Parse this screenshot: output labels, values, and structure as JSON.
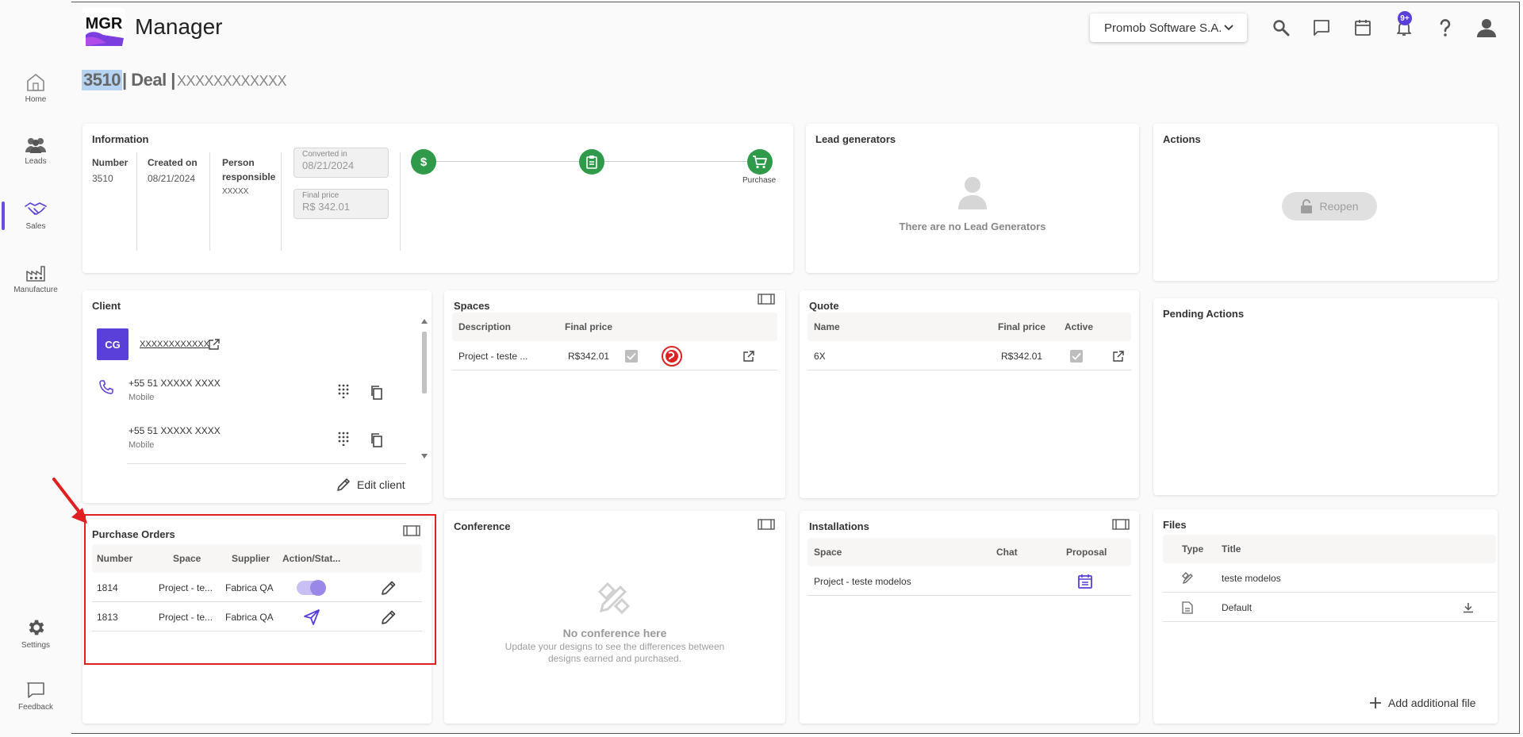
{
  "app": {
    "logo_text": "MGR",
    "title": "Manager"
  },
  "header": {
    "company": "Promob Software S.A.",
    "notification_badge": "9+"
  },
  "sidebar": [
    {
      "label": "Home",
      "icon": "home-icon"
    },
    {
      "label": "Leads",
      "icon": "people-icon"
    },
    {
      "label": "Sales",
      "icon": "handshake-icon",
      "active": true
    },
    {
      "label": "Manufacture",
      "icon": "factory-icon"
    },
    {
      "label": "Settings",
      "icon": "gear-icon"
    },
    {
      "label": "Feedback",
      "icon": "feedback-icon"
    }
  ],
  "deal": {
    "number": "3510",
    "label": "| Deal |",
    "name": "XXXXXXXXXXXX"
  },
  "information": {
    "title": "Information",
    "number_label": "Number",
    "number": "3510",
    "created_label": "Created on",
    "created": "08/21/2024",
    "person_label": "Person responsible",
    "person": "XXXXX",
    "converted_label": "Converted in",
    "converted": "08/21/2024",
    "price_label": "Final price",
    "price": "R$ 342.01",
    "step_label": "Purchase"
  },
  "lead_generators": {
    "title": "Lead generators",
    "empty": "There are no Lead Generators"
  },
  "actions": {
    "title": "Actions",
    "reopen": "Reopen"
  },
  "client": {
    "title": "Client",
    "initials": "CG",
    "name": "XXXXXXXXXXXX",
    "phones": [
      {
        "number": "+55 51 XXXXX XXXX",
        "type": "Mobile"
      },
      {
        "number": "+55 51 XXXXX XXXX",
        "type": "Mobile"
      }
    ],
    "edit": "Edit client"
  },
  "spaces": {
    "title": "Spaces",
    "headers": [
      "Description",
      "Final price"
    ],
    "rows": [
      {
        "description": "Project - teste ...",
        "price": "R$342.01"
      }
    ]
  },
  "quote": {
    "title": "Quote",
    "headers": [
      "Name",
      "Final price",
      "Active"
    ],
    "rows": [
      {
        "name": "6X",
        "price": "R$342.01"
      }
    ]
  },
  "pending_actions": {
    "title": "Pending Actions"
  },
  "purchase_orders": {
    "title": "Purchase Orders",
    "headers": [
      "Number",
      "Space",
      "Supplier",
      "Action/Stat..."
    ],
    "rows": [
      {
        "number": "1814",
        "space": "Project - te...",
        "supplier": "Fabrica QA"
      },
      {
        "number": "1813",
        "space": "Project - te...",
        "supplier": "Fabrica QA"
      }
    ]
  },
  "conference": {
    "title": "Conference",
    "empty_title": "No conference here",
    "empty_desc": "Update your designs to see the differences between designs earned and purchased."
  },
  "installations": {
    "title": "Installations",
    "headers": [
      "Space",
      "Chat",
      "Proposal"
    ],
    "rows": [
      {
        "space": "Project - teste modelos"
      }
    ]
  },
  "files": {
    "title": "Files",
    "headers": [
      "Type",
      "Title"
    ],
    "rows": [
      {
        "title": "teste modelos"
      },
      {
        "title": "Default"
      }
    ],
    "add": "Add additional file"
  },
  "colors": {
    "accent": "#5b3fd9",
    "success": "#2e9a4a",
    "highlight": "#e02020"
  }
}
